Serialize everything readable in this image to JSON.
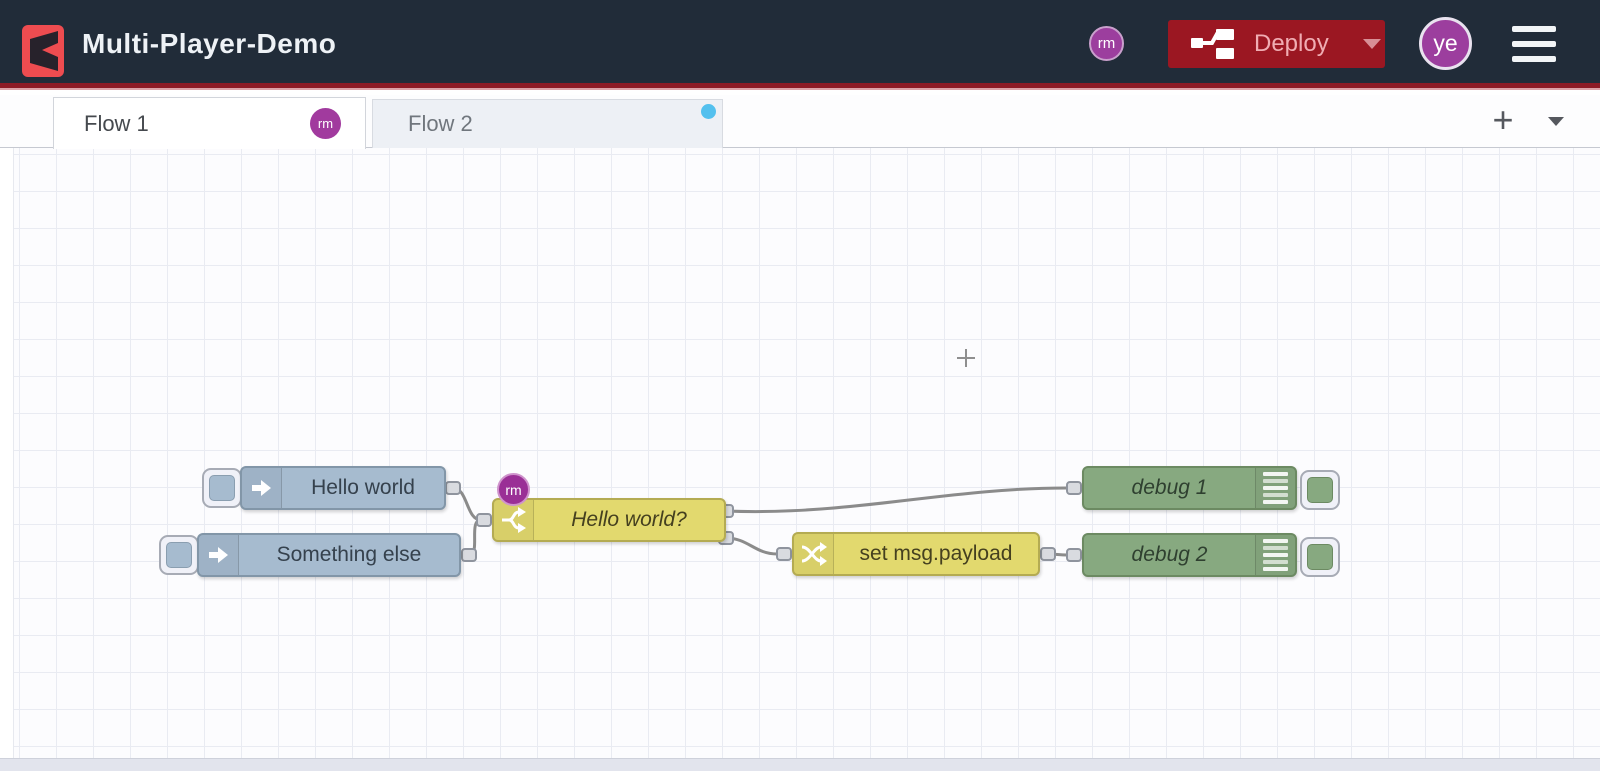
{
  "header": {
    "title": "Multi-Player-Demo",
    "collaborator_badge": "rm",
    "deploy": {
      "label": "Deploy"
    },
    "user_badge": "ye"
  },
  "tab_bar": {
    "tabs": [
      {
        "label": "Flow 1",
        "active": true,
        "badge": "rm"
      },
      {
        "label": "Flow 2",
        "active": false,
        "modified": true
      }
    ],
    "add_button": "+"
  },
  "canvas": {
    "nodes": [
      {
        "type": "inject",
        "label": "Hello world"
      },
      {
        "type": "inject",
        "label": "Something else"
      },
      {
        "type": "switch",
        "label": "Hello world?",
        "badge": "rm",
        "outputs": 2
      },
      {
        "type": "change",
        "label": "set msg.payload"
      },
      {
        "type": "debug",
        "label": "debug 1"
      },
      {
        "type": "debug",
        "label": "debug 2"
      }
    ],
    "wires": [
      "Hello world -> Hello world?",
      "Something else -> Hello world?",
      "Hello world? output 1 -> debug 1",
      "Hello world? output 2 -> set msg.payload",
      "set msg.payload -> debug 2"
    ]
  },
  "colors": {
    "header_bg": "#212c39",
    "accent_red": "#8d1b26",
    "deploy_button_bg": "#9b1722",
    "logo_red": "#ee4c50",
    "avatar_purple": "#9c3e9e",
    "inject_node": "#a6bbcf",
    "function_node_yellow": "#e2d96e",
    "debug_node_green": "#87a980",
    "modified_dot_blue": "#53c0ee",
    "wire_grey": "#8b8b8b"
  }
}
